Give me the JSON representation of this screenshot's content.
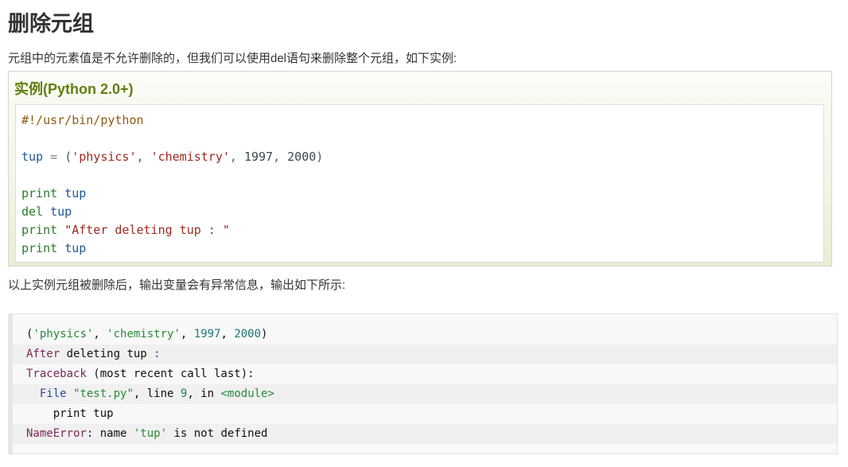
{
  "title": "删除元组",
  "intro": "元组中的元素值是不允许删除的，但我们可以使用del语句来删除整个元组，如下实例:",
  "example": {
    "title": "实例(Python 2.0+)",
    "code": {
      "shebang": "#!/usr/bin/python",
      "assign": {
        "var": "tup",
        "eq": " = ",
        "open": "(",
        "s1": "'physics'",
        "comma1": ", ",
        "s2": "'chemistry'",
        "comma2": ", ",
        "n1": "1997",
        "comma3": ", ",
        "n2": "2000",
        "close": ")"
      },
      "line_print1": {
        "kw": "print",
        "arg": "tup"
      },
      "line_del": {
        "kw": "del",
        "arg": "tup"
      },
      "line_print2": {
        "kw": "print",
        "arg": "\"After deleting tup : \""
      },
      "line_print3": {
        "kw": "print",
        "arg": "tup"
      }
    }
  },
  "outro": "以上实例元组被删除后，输出变量会有异常信息，输出如下所示:",
  "output": {
    "l1": {
      "open": "(",
      "s1": "'physics'",
      "c1": ", ",
      "s2": "'chemistry'",
      "c2": ", ",
      "n1": "1997",
      "c3": ", ",
      "n2": "2000",
      "close": ")"
    },
    "l2": {
      "name": "After",
      "rest": " deleting tup ",
      "colon": ":"
    },
    "l3": {
      "name": "Traceback",
      "rest": " (most recent call last):"
    },
    "l4": {
      "indent": "  ",
      "name": "File",
      "sp": " ",
      "str": "\"test.py\"",
      "mid": ", line ",
      "num": "9",
      "mid2": ", in ",
      "mod": "<module>"
    },
    "l5": {
      "text": "    print tup"
    },
    "l6": {
      "name": "NameError",
      "mid": ": name ",
      "str": "'tup'",
      "rest": " is not defined"
    }
  }
}
